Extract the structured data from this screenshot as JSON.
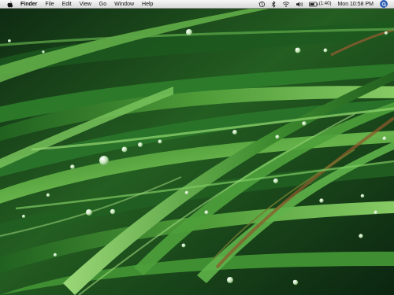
{
  "menubar": {
    "apple_icon": "apple-icon",
    "app_name": "Finder",
    "menus": [
      "File",
      "Edit",
      "View",
      "Go",
      "Window",
      "Help"
    ],
    "status": {
      "battery_time": "(1:40)",
      "clock": "Mon 10:58 PM",
      "icons": [
        "time-machine-icon",
        "bluetooth-icon",
        "wifi-icon",
        "volume-icon",
        "battery-icon",
        "spotlight-icon"
      ]
    }
  },
  "desktop": {
    "wallpaper": "green grass blades with dew drops",
    "colors": {
      "dark": "#0f2f13",
      "mid": "#2f7d25",
      "light": "#79c55e",
      "highlight": "#b8ec98"
    }
  }
}
